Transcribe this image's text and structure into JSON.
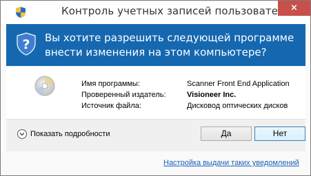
{
  "window": {
    "title": "Контроль учетных записей пользователей",
    "close_label": "×"
  },
  "banner": {
    "question": "Вы хотите разрешить следующей программе внести изменения на этом компьютере?",
    "icon": "uac-shield-question-icon"
  },
  "program": {
    "icon": "optical-disc-icon",
    "rows": [
      {
        "label": "Имя программы:",
        "value": "Scanner Front End Application"
      },
      {
        "label": "Проверенный издатель:",
        "value": "Visioneer Inc."
      },
      {
        "label": "Источник файла:",
        "value": "Дисковод оптических дисков"
      }
    ]
  },
  "footer": {
    "details_label": "Показать подробности",
    "yes_label": "Да",
    "no_label": "Нет",
    "notification_link": "Настройка выдачи таких уведомлений"
  },
  "colors": {
    "banner": "#1568b0",
    "close": "#c7504b",
    "link": "#1a5fb4"
  }
}
